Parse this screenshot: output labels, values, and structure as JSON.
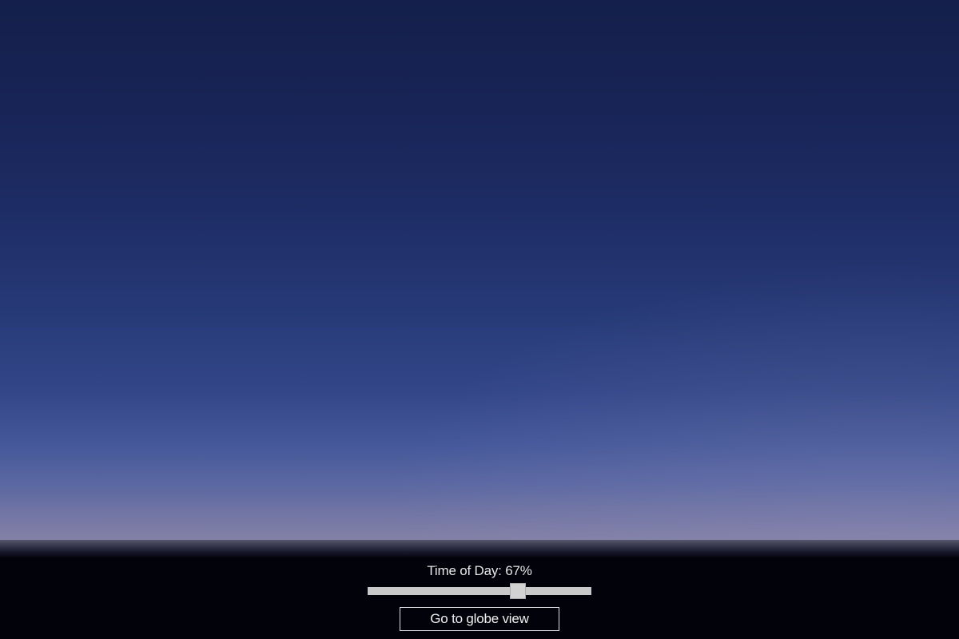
{
  "scene": {
    "sky_colors": {
      "zenith": "#141f4b",
      "mid": "#273a78",
      "horizon": "#8581a6",
      "ground": "#02020a"
    }
  },
  "controls": {
    "time_label": "Time of Day: 67%",
    "time_of_day_percent": 67,
    "globe_button_label": "Go to globe view"
  }
}
